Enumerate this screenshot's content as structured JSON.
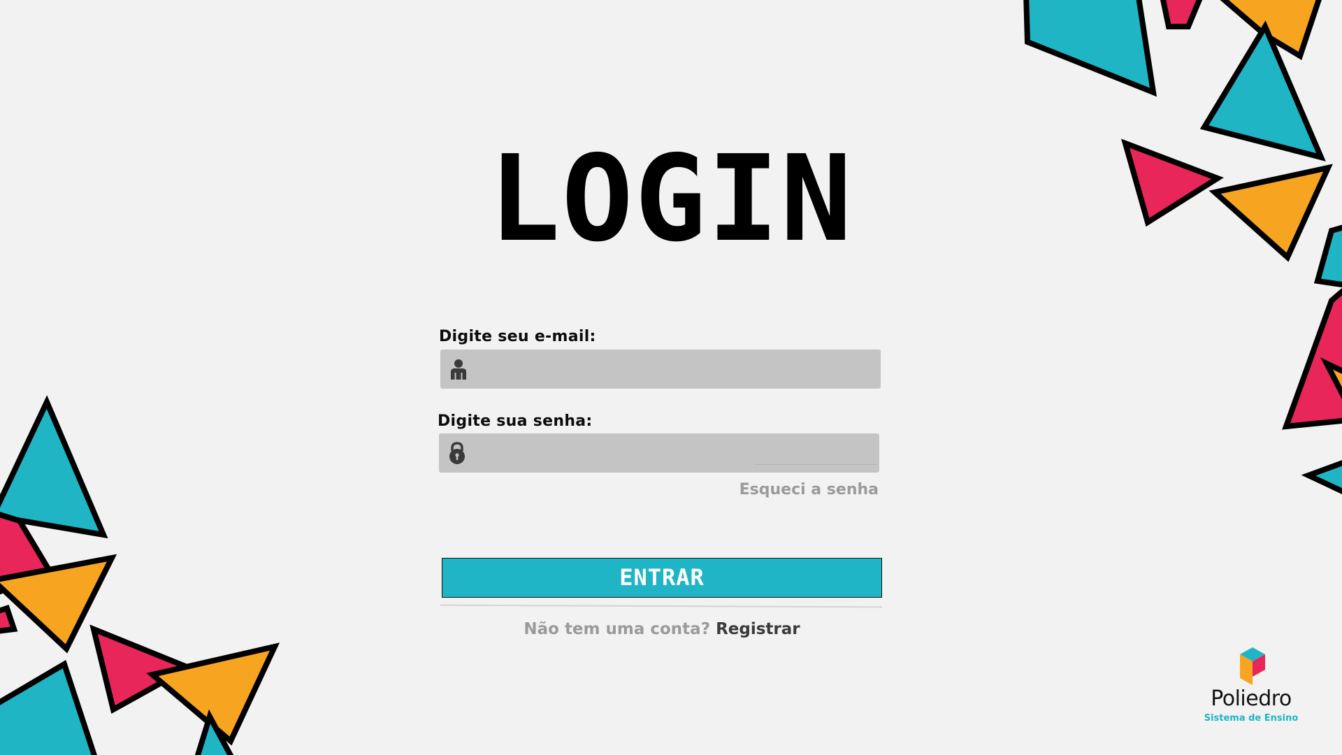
{
  "page": {
    "title": "LOGIN"
  },
  "form": {
    "email_label": "Digite seu e-mail:",
    "email_value": "",
    "email_placeholder": "",
    "email_icon": "user-icon",
    "password_label": "Digite sua senha:",
    "password_value": "",
    "password_placeholder": "",
    "password_icon": "lock-icon",
    "forgot_link": "Esqueci a senha",
    "submit_label": "ENTRAR"
  },
  "register": {
    "prompt": "Não tem uma conta?",
    "link": "Registrar"
  },
  "brand": {
    "name": "Poliedro",
    "tagline": "Sistema de Ensino"
  },
  "colors": {
    "background": "#f2f2f2",
    "accent": "#20b5c6",
    "input_bg": "#c4c4c4",
    "deco_teal": "#1fb5c5",
    "deco_pink": "#e8265a",
    "deco_orange": "#f7a520"
  }
}
